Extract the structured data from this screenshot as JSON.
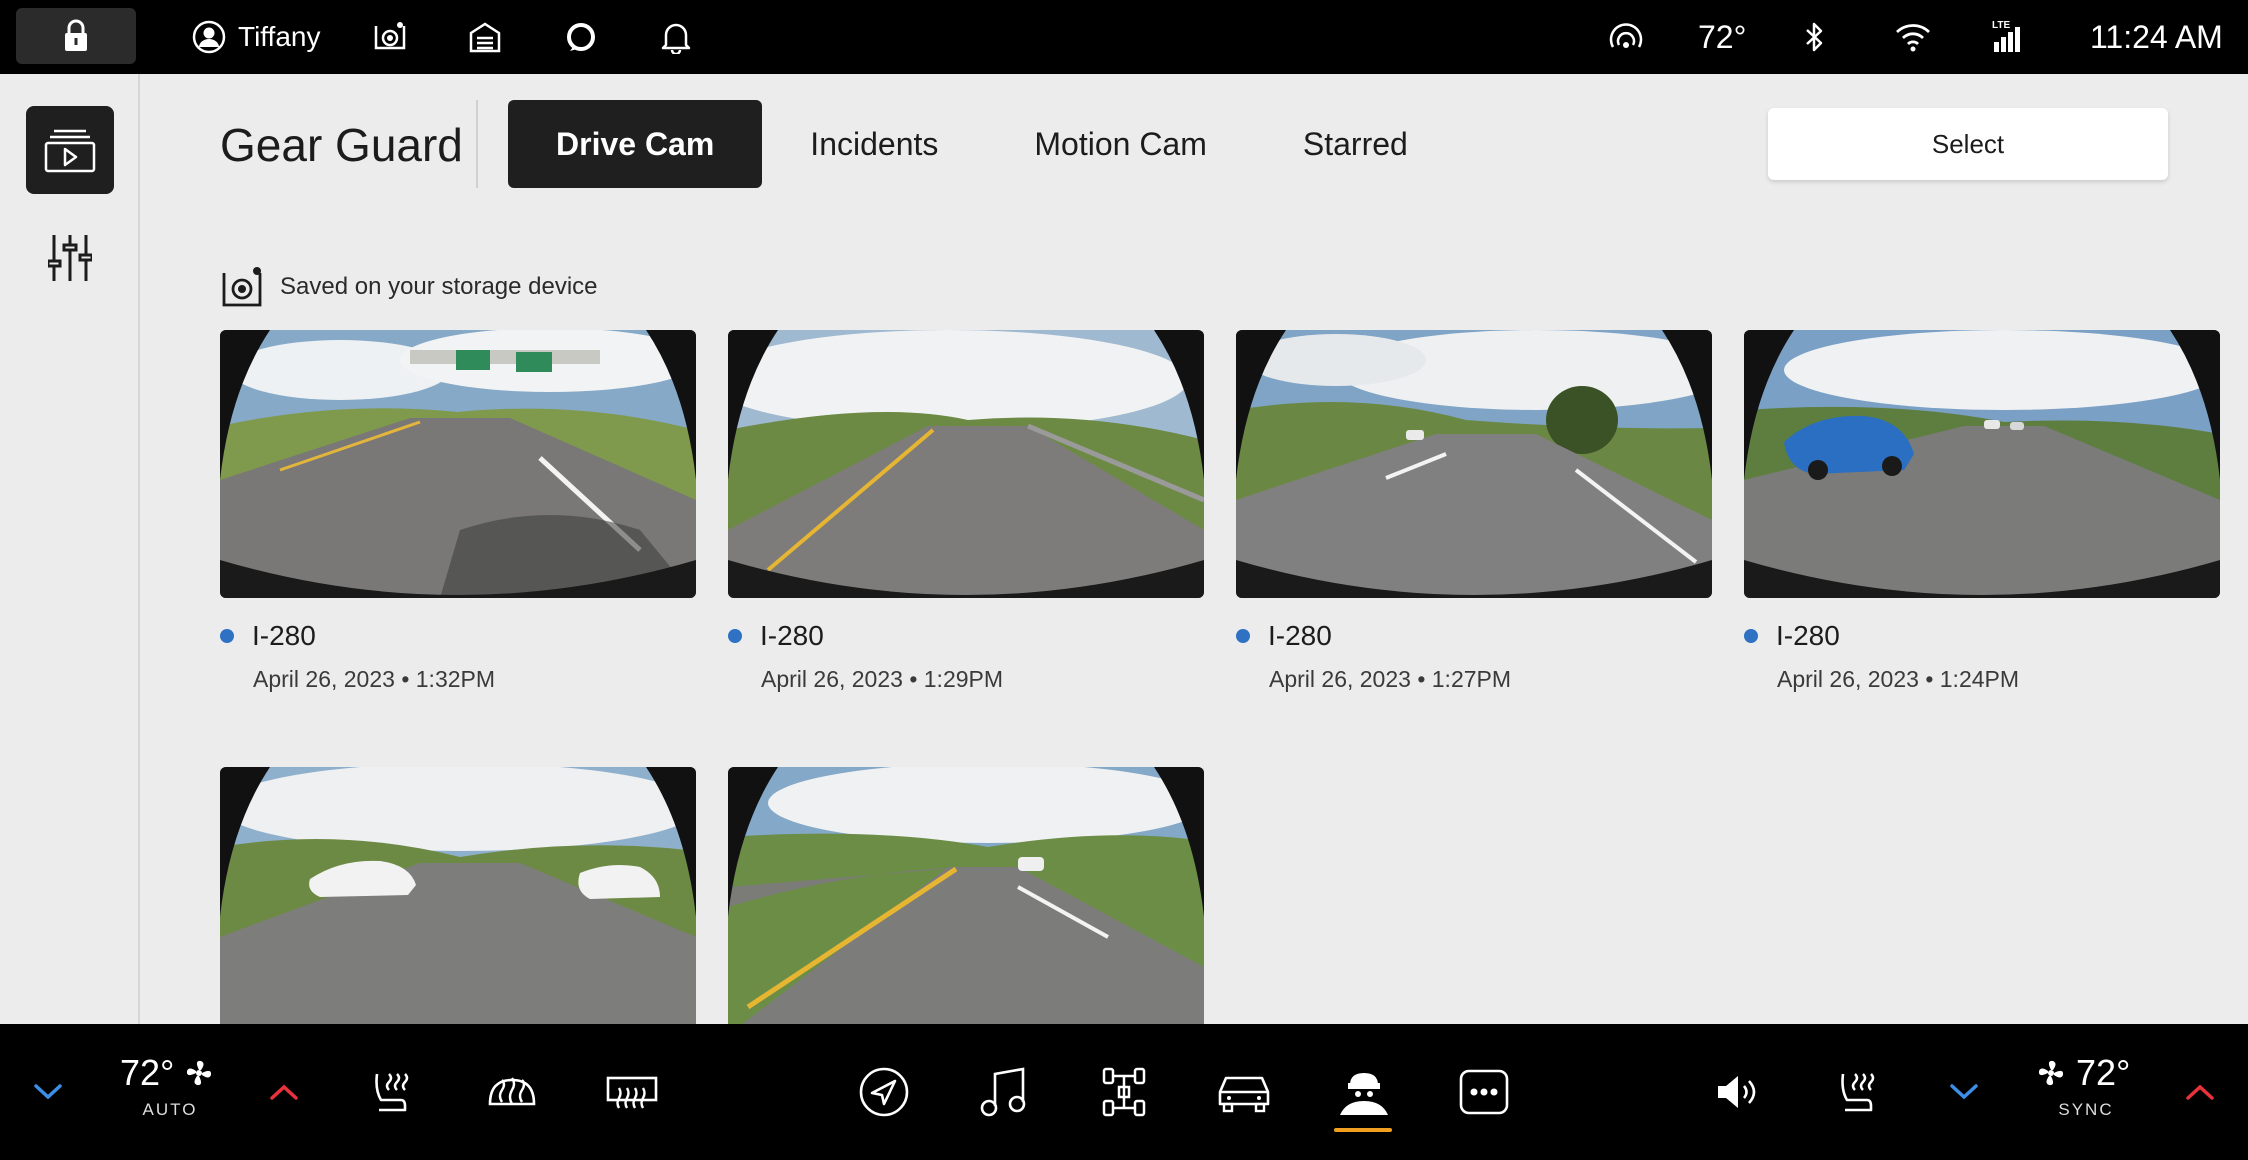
{
  "status_bar": {
    "user_name": "Tiffany",
    "temperature": "72°",
    "time": "11:24 AM",
    "signal_label": "LTE",
    "icons": [
      "lock-icon",
      "user-icon",
      "gear-guard-camera-icon",
      "garage-icon",
      "alexa-ring-icon",
      "bell-icon",
      "remote-signal-icon",
      "bluetooth-icon",
      "wifi-icon",
      "lte-signal-icon"
    ]
  },
  "sidebar": {
    "items": [
      {
        "name": "gallery",
        "icon": "video-gallery-icon",
        "active": true
      },
      {
        "name": "settings",
        "icon": "sliders-icon",
        "active": false
      }
    ]
  },
  "header": {
    "title": "Gear Guard",
    "tabs": [
      {
        "label": "Drive Cam",
        "active": true
      },
      {
        "label": "Incidents",
        "active": false
      },
      {
        "label": "Motion Cam",
        "active": false
      },
      {
        "label": "Starred",
        "active": false
      }
    ],
    "select_label": "Select"
  },
  "storage": {
    "label": "Saved on your storage device",
    "icon": "gear-guard-camera-icon"
  },
  "clips": [
    {
      "title": "I-280",
      "date": "April 26, 2023 • 1:32PM",
      "status_color": "#2f72c4",
      "scene": "overpass"
    },
    {
      "title": "I-280",
      "date": "April 26, 2023 • 1:29PM",
      "status_color": "#2f72c4",
      "scene": "guardrail"
    },
    {
      "title": "I-280",
      "date": "April 26, 2023 • 1:27PM",
      "status_color": "#2f72c4",
      "scene": "tree"
    },
    {
      "title": "I-280",
      "date": "April 26, 2023 • 1:24PM",
      "status_color": "#2f72c4",
      "scene": "blue-car"
    },
    {
      "title": "",
      "date": "",
      "status_color": "#2f72c4",
      "scene": "white-cars"
    },
    {
      "title": "",
      "date": "",
      "status_color": "#2f72c4",
      "scene": "median"
    }
  ],
  "climate": {
    "driver_temp": "72°",
    "driver_mode": "AUTO",
    "passenger_temp": "72°",
    "passenger_mode": "SYNC",
    "down_color": "#3d8ee6",
    "up_color": "#e8323c"
  },
  "dock": {
    "items": [
      "heated-seat-icon",
      "front-defrost-icon",
      "rear-defrost-icon",
      "navigation-icon",
      "music-icon",
      "drive-modes-icon",
      "vehicle-icon",
      "gear-guard-icon",
      "more-icon",
      "volume-icon",
      "passenger-heated-seat-icon"
    ],
    "active": "gear-guard-icon",
    "active_color": "#f0a01e"
  }
}
